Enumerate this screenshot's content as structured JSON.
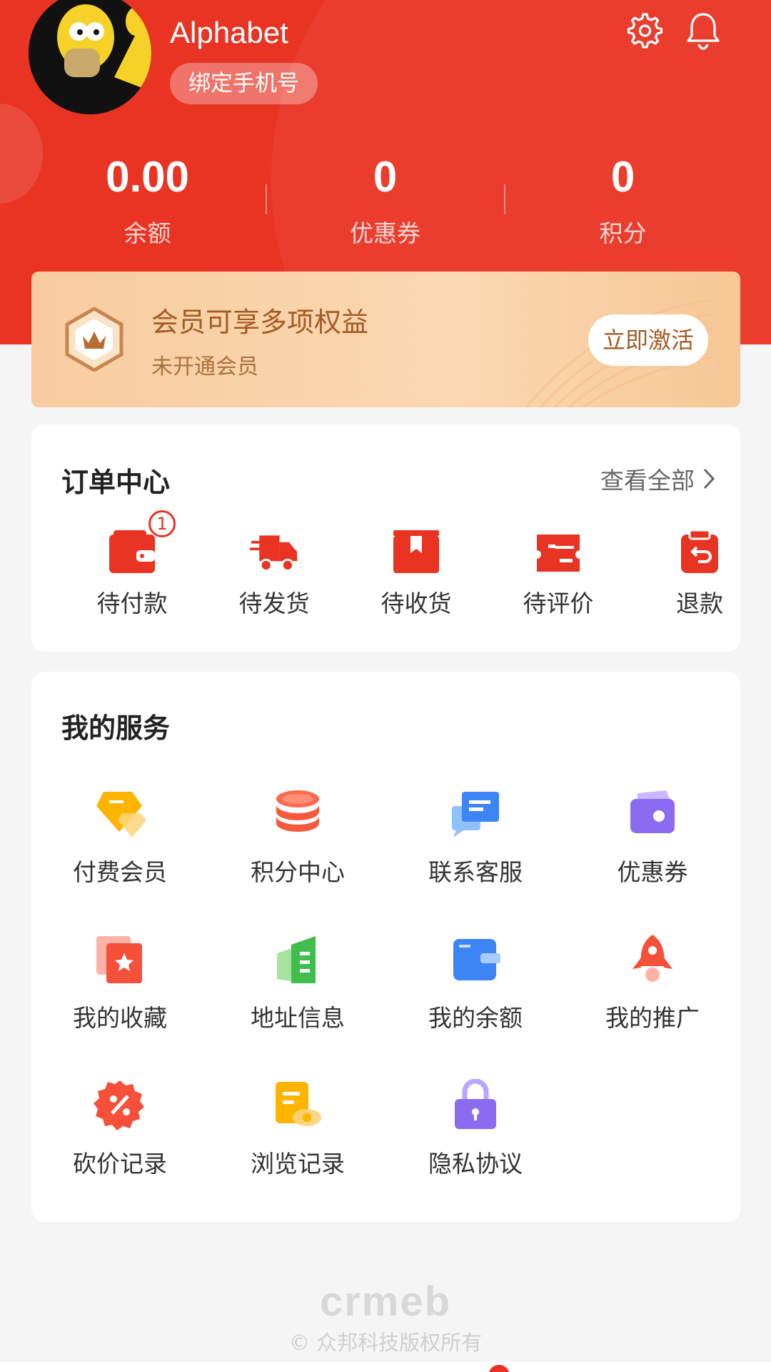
{
  "profile": {
    "username": "Alphabet",
    "bind_phone_label": "绑定手机号"
  },
  "header_icons": [
    "gear-icon",
    "bell-icon"
  ],
  "stats": [
    {
      "value": "0.00",
      "label": "余额"
    },
    {
      "value": "0",
      "label": "优惠券"
    },
    {
      "value": "0",
      "label": "积分"
    }
  ],
  "vip": {
    "title": "会员可享多项权益",
    "subtitle": "未开通会员",
    "button_label": "立即激活"
  },
  "orders": {
    "title": "订单中心",
    "view_all_label": "查看全部",
    "items": [
      {
        "label": "待付款",
        "badge": "1",
        "icon": "wallet-icon"
      },
      {
        "label": "待发货",
        "icon": "truck-icon"
      },
      {
        "label": "待收货",
        "icon": "box-icon"
      },
      {
        "label": "待评价",
        "icon": "ticket-icon"
      },
      {
        "label": "退款",
        "icon": "refund-bag-icon"
      }
    ]
  },
  "services": {
    "title": "我的服务",
    "items": [
      {
        "label": "付费会员",
        "icon": "vip-tag-icon"
      },
      {
        "label": "积分中心",
        "icon": "coin-stack-icon"
      },
      {
        "label": "联系客服",
        "icon": "chat-icon"
      },
      {
        "label": "优惠券",
        "icon": "coupon-wallet-icon"
      },
      {
        "label": "我的收藏",
        "icon": "favorite-star-icon"
      },
      {
        "label": "地址信息",
        "icon": "address-book-icon"
      },
      {
        "label": "我的余额",
        "icon": "balance-wallet-icon"
      },
      {
        "label": "我的推广",
        "icon": "rocket-icon"
      },
      {
        "label": "砍价记录",
        "icon": "discount-icon"
      },
      {
        "label": "浏览记录",
        "icon": "browse-history-icon"
      },
      {
        "label": "隐私协议",
        "icon": "lock-icon"
      }
    ]
  },
  "footer": {
    "logo": "crmeb",
    "copyright": "© 众邦科技版权所有"
  },
  "colors": {
    "brand_red": "#e93323",
    "vip_gold": "#a35b24"
  }
}
